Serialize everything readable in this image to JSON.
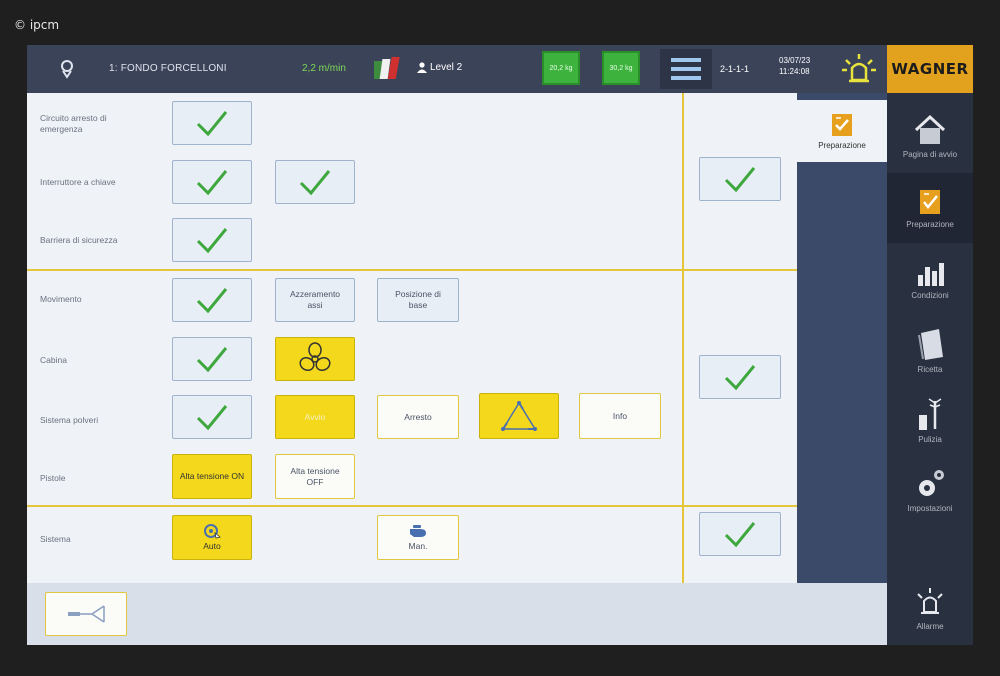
{
  "watermark": "© ipcm",
  "header": {
    "program": "1: FONDO FORCELLONI",
    "speed": "2,2 m/min",
    "level": "Level 2",
    "gauge_1": "20,2 kg",
    "gauge_2": "30,2 kg",
    "code": "2-1-1-1",
    "date": "03/07/23",
    "time": "11:24:08"
  },
  "brand": "WAGNER",
  "nav": [
    {
      "label": "Pagina di avvio",
      "icon": "home-icon"
    },
    {
      "label": "Preparazione",
      "icon": "checklist-icon"
    },
    {
      "label": "Condizioni",
      "icon": "bar-chart-icon"
    },
    {
      "label": "Ricetta",
      "icon": "notebook-icon"
    },
    {
      "label": "Pulizia",
      "icon": "cleaning-icon"
    },
    {
      "label": "Impostazioni",
      "icon": "gear-icon"
    },
    {
      "label": "Allarme",
      "icon": "alarm-icon"
    }
  ],
  "side_tab": "Preparazione",
  "rows": {
    "emergency": "Circuito arresto di emergenza",
    "key_switch": "Interruttore a chiave",
    "safety_barrier": "Barriera di sicurezza",
    "movement": "Movimento",
    "booth": "Cabina",
    "powder_system": "Sistema polveri",
    "guns": "Pistole",
    "system": "Sistema"
  },
  "buttons": {
    "axis_reset": "Azzeramento assi",
    "base_position": "Posizione di base",
    "start": "Avvio",
    "stop": "Arresto",
    "info": "Info",
    "high_voltage_on": "Alta tensione ON",
    "high_voltage_off": "Alta tensione OFF",
    "auto": "Auto",
    "manual": "Man."
  },
  "colors": {
    "header_bg": "#3a4358",
    "brand_bg": "#e2a21d",
    "accent_yellow": "#f3d81b",
    "check_green": "#3ea83e"
  }
}
